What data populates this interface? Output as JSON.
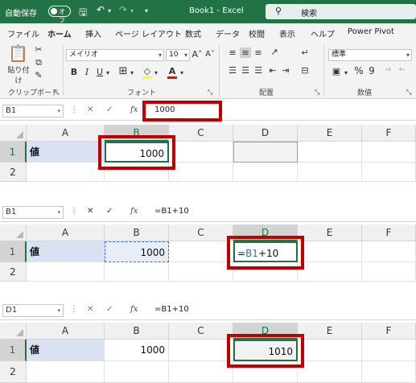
{
  "titlebar": {
    "autosave_label": "自動保存",
    "autosave_state": "オフ",
    "doc_title": "Book1 - Excel",
    "search_placeholder": "検索"
  },
  "menu": [
    "ファイル",
    "ホーム",
    "挿入",
    "ページ レイアウト",
    "数式",
    "データ",
    "校閲",
    "表示",
    "ヘルプ",
    "Power Pivot"
  ],
  "ribbon": {
    "paste_label": "貼り付け",
    "clipboard_label": "クリップボード",
    "font_name": "メイリオ",
    "font_size": "10",
    "font_group_label": "フォント",
    "align_group_label": "配置",
    "number_format": "標準",
    "number_group_label": "数値",
    "bold": "B",
    "italic": "I",
    "underline": "U",
    "percent": "%",
    "comma": "9"
  },
  "panels": [
    {
      "namebox": "B1",
      "formula": "1000",
      "col_headers": [
        "A",
        "B",
        "C",
        "D",
        "E",
        "F"
      ],
      "rows": [
        "1",
        "2"
      ],
      "a1": "値",
      "b1": "1000",
      "d1": ""
    },
    {
      "namebox": "B1",
      "formula": "=B1+10",
      "col_headers": [
        "A",
        "B",
        "C",
        "D",
        "E",
        "F"
      ],
      "rows": [
        "1",
        "2"
      ],
      "a1": "値",
      "b1": "1000",
      "d1_eq": "=",
      "d1_ref": "B1",
      "d1_rest": "+10"
    },
    {
      "namebox": "D1",
      "formula": "=B1+10",
      "col_headers": [
        "A",
        "B",
        "C",
        "D",
        "E",
        "F"
      ],
      "rows": [
        "1",
        "2"
      ],
      "a1": "値",
      "b1": "1000",
      "d1": "1010"
    }
  ],
  "colors": {
    "excel_green": "#217346",
    "highlight_red": "#c00000",
    "label_fill": "#d9e1f2",
    "ref_blue": "#3a6fc4"
  }
}
